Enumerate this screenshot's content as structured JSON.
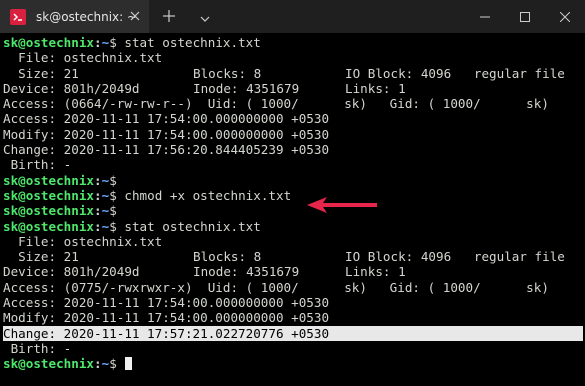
{
  "window": {
    "tab_title": "sk@ostechnix: ~",
    "icons": {
      "tab_icon": "terminal-icon",
      "close": "close-icon",
      "new_tab": "plus-icon",
      "dropdown": "chevron-down-icon",
      "minimize": "minimize-icon",
      "maximize": "maximize-icon",
      "window_close": "close-icon"
    }
  },
  "colors": {
    "prompt_user": "#4ee66b",
    "prompt_path": "#6fa8ff",
    "text": "#d3d7cf",
    "background": "#000000",
    "arrow": "#e8254b",
    "highlight_bg": "#e8e8e8"
  },
  "prompt": {
    "user": "sk@ostechnix",
    "sep": ":",
    "path": "~",
    "dollar": "$"
  },
  "commands": {
    "stat1": " stat ostechnix.txt",
    "blank1": "",
    "chmod": " chmod +x ostechnix.txt",
    "blank2": "",
    "stat2": " stat ostechnix.txt",
    "final": " "
  },
  "stat1": {
    "file": "  File: ostechnix.txt",
    "size_a": "  Size: 21",
    "size_b": "Blocks: 8",
    "size_c": "IO Block: 4096   regular file",
    "device_a": "Device: 801h/2049d",
    "device_b": "Inode: 4351679",
    "device_c": "Links: 1",
    "access_perm": "Access: (0664/-rw-rw-r--)  Uid: ( 1000/      sk)   Gid: ( 1000/      sk)",
    "access_time": "Access: 2020-11-11 17:54:00.000000000 +0530",
    "modify_time": "Modify: 2020-11-11 17:54:00.000000000 +0530",
    "change_time": "Change: 2020-11-11 17:56:20.844405239 +0530",
    "birth": " Birth: -"
  },
  "stat2": {
    "file": "  File: ostechnix.txt",
    "size_a": "  Size: 21",
    "size_b": "Blocks: 8",
    "size_c": "IO Block: 4096   regular file",
    "device_a": "Device: 801h/2049d",
    "device_b": "Inode: 4351679",
    "device_c": "Links: 1",
    "access_perm": "Access: (0775/-rwxrwxr-x)  Uid: ( 1000/      sk)   Gid: ( 1000/      sk)",
    "access_time": "Access: 2020-11-11 17:54:00.000000000 +0530",
    "modify_time": "Modify: 2020-11-11 17:54:00.000000000 +0530",
    "change_time": "Change: 2020-11-11 17:57:21.022720776 +0530",
    "birth": " Birth: -"
  }
}
